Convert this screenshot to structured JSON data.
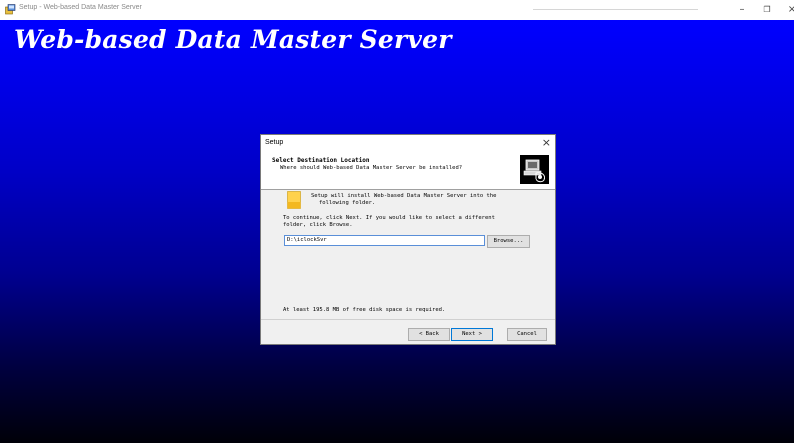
{
  "window": {
    "title": "Setup - Web-based Data Master Server",
    "controls": [
      "minimize-icon",
      "restore-icon",
      "close-icon"
    ],
    "minimize_glyph": "–",
    "restore_glyph": "❐",
    "close_glyph": "×"
  },
  "background": {
    "title": "Web-based Data Master Server",
    "gradient_colors": [
      "#0000ff",
      "#000000"
    ]
  },
  "dialog": {
    "title": "Setup",
    "close_glyph": "×",
    "header": {
      "title": "Select Destination Location",
      "subtitle": "Where should Web-based Data Master Server be installed?",
      "icon": "install-computer-icon"
    },
    "intro_line1": "Setup will install Web-based Data Master Server into the",
    "intro_line2": "following folder.",
    "continue_line1": "To continue, click Next. If you would like to select a different",
    "continue_line2": "folder, click Browse.",
    "path_value": "D:\\iclockSvr",
    "browse_label": "Browse...",
    "space_required": "At least 195.8 MB of free disk space is required.",
    "back_label": "< Back",
    "next_label": "Next >",
    "cancel_label": "Cancel",
    "folder_icon": "folder-icon"
  }
}
